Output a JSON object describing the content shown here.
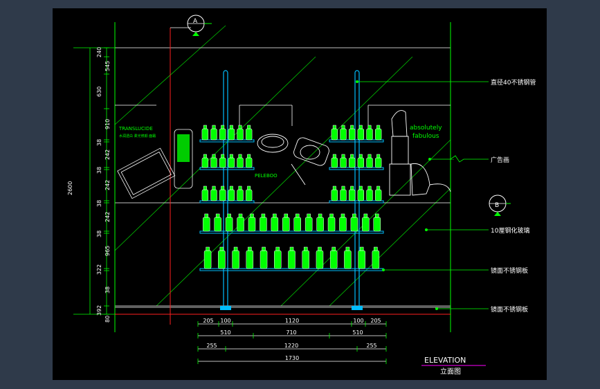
{
  "drawing": {
    "title": "ELEVATION",
    "subtitle": "立面图",
    "section_markers": [
      "A",
      "B"
    ],
    "callouts": [
      "直径40不锈钢管",
      "广告画",
      "10厘钢化玻璃",
      "镜面不锈钢板",
      "镜面不锈钢板"
    ],
    "left_dims_inner": [
      "240",
      "545",
      "630",
      "910",
      "38",
      "242",
      "38",
      "242",
      "38",
      "242",
      "38",
      "965",
      "322",
      "38",
      "392",
      "80"
    ],
    "left_dim_total": "2600",
    "bottom_dims": {
      "row1": [
        "205",
        "100",
        "1120",
        "100",
        "205"
      ],
      "row2": [
        "510",
        "710",
        "510"
      ],
      "row3": [
        "255",
        "1220",
        "255"
      ],
      "row4": [
        "1730"
      ]
    },
    "poster_text": {
      "translucide": "TRANSLUCIDE",
      "translucide_sub": "水润透白 柔光修颜 面霜",
      "absolutely": "absolutely",
      "fabulous": "fabulous",
      "product_label": "PELEBOO"
    }
  }
}
